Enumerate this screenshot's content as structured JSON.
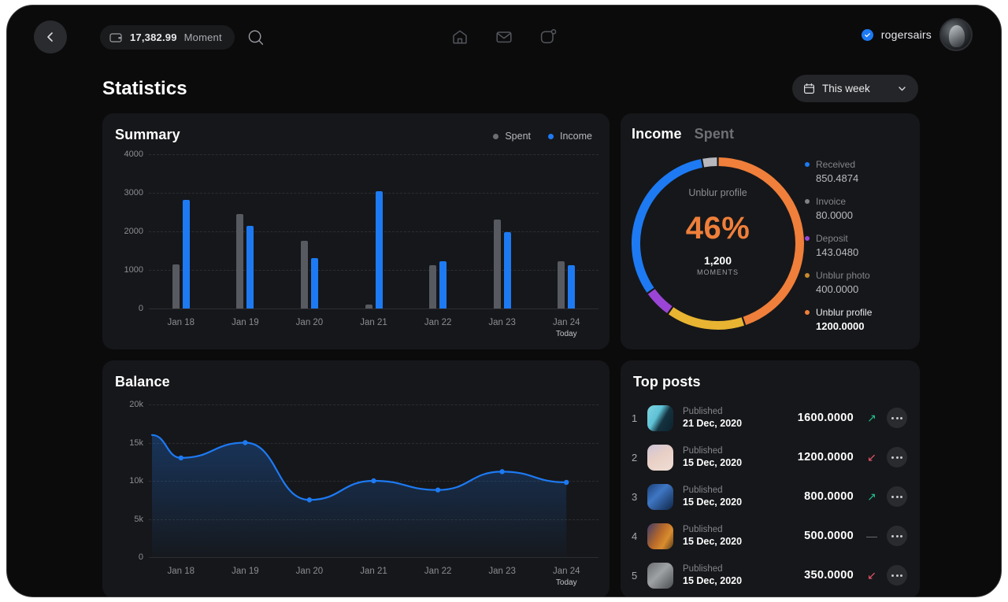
{
  "header": {
    "back_icon": "chevron-left-icon",
    "wallet_icon": "wallet-icon",
    "wallet_amount": "17,382.99",
    "wallet_label": "Moment",
    "search_icon": "search-icon",
    "nav": [
      {
        "icon": "home-icon",
        "name": "home"
      },
      {
        "icon": "mail-icon",
        "name": "messages"
      },
      {
        "icon": "notification-icon",
        "name": "notifications"
      }
    ],
    "verified_icon": "verified-check-icon",
    "username": "rogersairs",
    "avatar": "user-avatar"
  },
  "page": {
    "title": "Statistics",
    "range_icon": "calendar-icon",
    "range_value": "This week",
    "range_chevron": "chevron-down-icon"
  },
  "summary": {
    "title": "Summary",
    "legend": [
      {
        "label": "Spent",
        "color": "#6b6e74"
      },
      {
        "label": "Income",
        "color": "#1d7af3"
      }
    ]
  },
  "income": {
    "tabs": [
      {
        "label": "Income",
        "active": true
      },
      {
        "label": "Spent",
        "active": false
      }
    ],
    "donut_caption": "Unblur profile",
    "donut_percent": "46%",
    "donut_number": "1,200",
    "donut_unit": "MOMENTS",
    "stats": [
      {
        "name": "Received",
        "value": "850.4874",
        "color": "#1d7af3",
        "active": false
      },
      {
        "name": "Invoice",
        "value": "80.0000",
        "color": "#7e8187",
        "active": false
      },
      {
        "name": "Deposit",
        "value": "143.0480",
        "color": "#9b45d6",
        "active": false
      },
      {
        "name": "Unblur photo",
        "value": "400.0000",
        "color": "#c98a2c",
        "active": false
      },
      {
        "name": "Unblur profile",
        "value": "1200.0000",
        "color": "#ef7f3a",
        "active": true
      }
    ]
  },
  "balance": {
    "title": "Balance"
  },
  "top_posts": {
    "title": "Top posts",
    "more_icon": "ellipsis-icon",
    "rows": [
      {
        "rank": "1",
        "status": "Published",
        "date": "21 Dec, 2020",
        "amount": "1600.0000",
        "trend": "up",
        "trend_icon": "arrow-up-right-icon",
        "thumb": "city-buildings-thumb"
      },
      {
        "rank": "2",
        "status": "Published",
        "date": "15 Dec, 2020",
        "amount": "1200.0000",
        "trend": "down",
        "trend_icon": "arrow-down-left-icon",
        "thumb": "bokeh-lights-thumb"
      },
      {
        "rank": "3",
        "status": "Published",
        "date": "15 Dec, 2020",
        "amount": "800.0000",
        "trend": "up",
        "trend_icon": "arrow-up-right-icon",
        "thumb": "blue-gem-thumb"
      },
      {
        "rank": "4",
        "status": "Published",
        "date": "15 Dec, 2020",
        "amount": "500.0000",
        "trend": "flat",
        "trend_icon": "dash-icon",
        "thumb": "textile-market-thumb"
      },
      {
        "rank": "5",
        "status": "Published",
        "date": "15 Dec, 2020",
        "amount": "350.0000",
        "trend": "down",
        "trend_icon": "arrow-down-left-icon",
        "thumb": "sneakers-thumb"
      }
    ]
  },
  "colors": {
    "accent_blue": "#1d7af3",
    "accent_orange": "#ef7f3a",
    "spent_gray": "#575a60",
    "trend_up": "#1fc08a",
    "trend_down": "#e8566c",
    "trend_flat": "#6e7076",
    "card_bg": "#16171a",
    "page_bg": "#0b0b0c"
  },
  "chart_data": [
    {
      "type": "bar",
      "title": "Summary",
      "categories": [
        "Jan 18",
        "Jan 19",
        "Jan 20",
        "Jan 21",
        "Jan 22",
        "Jan 23",
        "Jan 24"
      ],
      "today_index": 6,
      "today_label": "Today",
      "series": [
        {
          "name": "Spent",
          "color": "#575a60",
          "values": [
            1150,
            2450,
            1750,
            100,
            1130,
            2300,
            1230
          ]
        },
        {
          "name": "Income",
          "color": "#1d7af3",
          "values": [
            2820,
            2150,
            1300,
            3050,
            1220,
            1980,
            1120
          ]
        }
      ],
      "yticks": [
        "4000",
        "3000",
        "2000",
        "1000",
        "0"
      ],
      "ylim": [
        0,
        4000
      ],
      "xlabel": "",
      "ylabel": "",
      "grid": true,
      "legend_position": "top-right"
    },
    {
      "type": "pie",
      "title": "Income",
      "subtitle": "Unblur profile",
      "center_value": "46%",
      "labels": [
        "Unblur profile",
        "Unblur photo",
        "Deposit",
        "Received",
        "Invoice"
      ],
      "values": [
        1200.0,
        400.0,
        143.048,
        850.4874,
        80.0
      ],
      "percentages": [
        45.6,
        15.2,
        5.4,
        30.8,
        3.0
      ],
      "colors": [
        "#ef7f3a",
        "#e8b431",
        "#9b45d6",
        "#1d7af3",
        "#b6b8bd"
      ],
      "legend_position": "right",
      "donut": true
    },
    {
      "type": "area",
      "title": "Balance",
      "categories": [
        "Jan 18",
        "Jan 19",
        "Jan 20",
        "Jan 21",
        "Jan 22",
        "Jan 23",
        "Jan 24"
      ],
      "today_index": 6,
      "today_label": "Today",
      "series": [
        {
          "name": "Balance",
          "color": "#1d7af3",
          "values": [
            13000,
            15000,
            7500,
            10000,
            8800,
            11200,
            9800
          ],
          "start_value": 16000
        }
      ],
      "yticks": [
        "20k",
        "15k",
        "10k",
        "5k",
        "0"
      ],
      "ylim": [
        0,
        20000
      ],
      "xlabel": "",
      "ylabel": "",
      "grid": true,
      "legend_position": "none"
    }
  ]
}
